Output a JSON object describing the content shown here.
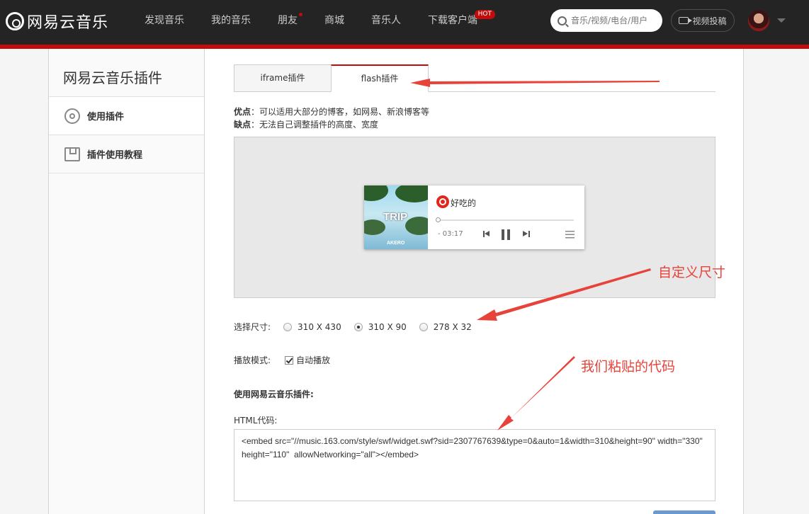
{
  "header": {
    "logo_text": "网易云音乐",
    "nav": [
      {
        "label": "发现音乐"
      },
      {
        "label": "我的音乐"
      },
      {
        "label": "朋友"
      },
      {
        "label": "商城"
      },
      {
        "label": "音乐人"
      },
      {
        "label": "下载客户端"
      }
    ],
    "hot_badge": "HOT",
    "search_placeholder": "音乐/视频/电台/用户",
    "upload_label": "视频投稿"
  },
  "sidebar": {
    "title": "网易云音乐插件",
    "items": [
      {
        "label": "使用插件",
        "icon": "gear-icon"
      },
      {
        "label": "插件使用教程",
        "icon": "book-icon"
      }
    ]
  },
  "main": {
    "tabs": [
      {
        "label": "iframe插件"
      },
      {
        "label": "flash插件"
      }
    ],
    "pros_label": "优点",
    "pros_text": "：可以适用大部分的博客，如网易、新浪博客等",
    "cons_label": "缺点",
    "cons_text": "：无法自己调整插件的高度、宽度",
    "player": {
      "cover_title": "TRIP",
      "cover_sub": "AKERO",
      "song": "好吃的",
      "time": "- 03:17"
    },
    "size_label": "选择尺寸:",
    "sizes": [
      {
        "label": "310 X 430",
        "selected": false
      },
      {
        "label": "310 X 90",
        "selected": true
      },
      {
        "label": "278 X 32",
        "selected": false
      }
    ],
    "mode_label": "播放模式:",
    "autoplay_label": "自动播放",
    "use_title": "使用网易云音乐插件:",
    "html_label": "HTML代码:",
    "code": "<embed src=\"//music.163.com/style/swf/widget.swf?sid=2307767639&type=0&auto=1&width=310&height=90\" width=\"330\" height=\"110\"  allowNetworking=\"all\"></embed>"
  },
  "annotations": {
    "custom_size": "自定义尺寸",
    "pasted_code": "我们粘贴的代码",
    "color": "#e8433a"
  }
}
